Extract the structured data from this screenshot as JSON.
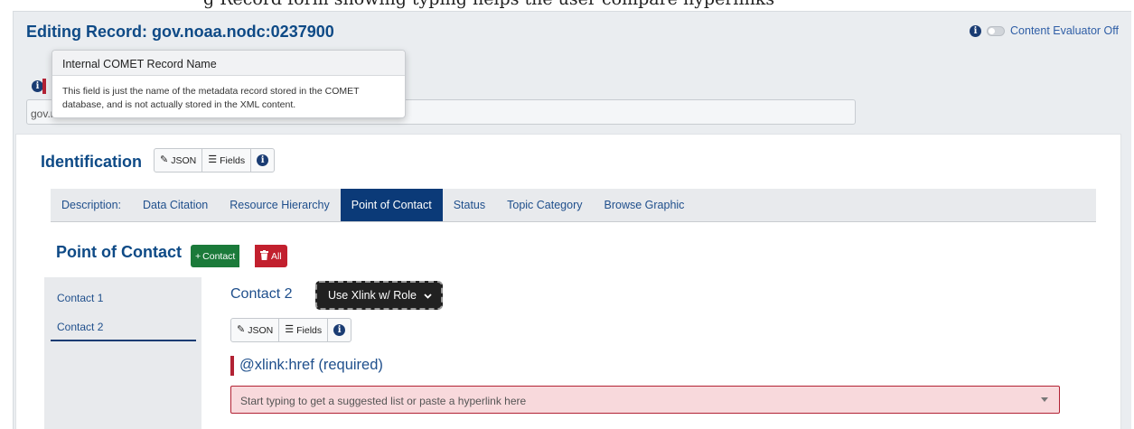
{
  "caption": "g Record form showing typing helps the user compare hyperlinks",
  "header": {
    "title": "Editing Record: gov.noaa.nodc:0237900",
    "evaluator_label": "Content Evaluator Off"
  },
  "record_name": {
    "value": "gov.noaa.nodc:0237900"
  },
  "tooltip": {
    "title": "Internal COMET Record Name",
    "body": "This field is just the name of the metadata record stored in the COMET database, and is not actually stored in the XML content."
  },
  "identification": {
    "title": "Identification",
    "json_label": "JSON",
    "fields_label": "Fields"
  },
  "tabs": [
    {
      "label": "Description:"
    },
    {
      "label": "Data Citation"
    },
    {
      "label": "Resource Hierarchy"
    },
    {
      "label": "Point of Contact",
      "active": true
    },
    {
      "label": "Status"
    },
    {
      "label": "Topic Category"
    },
    {
      "label": "Browse Graphic"
    }
  ],
  "point_of_contact": {
    "title": "Point of Contact",
    "add_label": "Contact",
    "delete_all_label": "All"
  },
  "contacts": [
    {
      "label": "Contact 1"
    },
    {
      "label": "Contact 2",
      "selected": true
    }
  ],
  "contact_detail": {
    "title": "Contact 2",
    "xlink_button": "Use Xlink w/ Role",
    "json_label": "JSON",
    "fields_label": "Fields",
    "href_label": "@xlink:href (required)",
    "href_placeholder": "Start typing to get a suggested list or paste a hyperlink here"
  },
  "colors": {
    "brand_blue": "#0e4a86",
    "active_tab": "#0b3a78",
    "add_green": "#1b7a3a",
    "delete_red": "#c2202e",
    "required_red": "#b22234",
    "invalid_bg": "#f8d9dc"
  },
  "icons": [
    "info-icon",
    "toggle-icon",
    "pencil-icon",
    "list-icon",
    "plus-icon",
    "trash-icon",
    "chevron-down-icon",
    "caret-down-icon"
  ]
}
